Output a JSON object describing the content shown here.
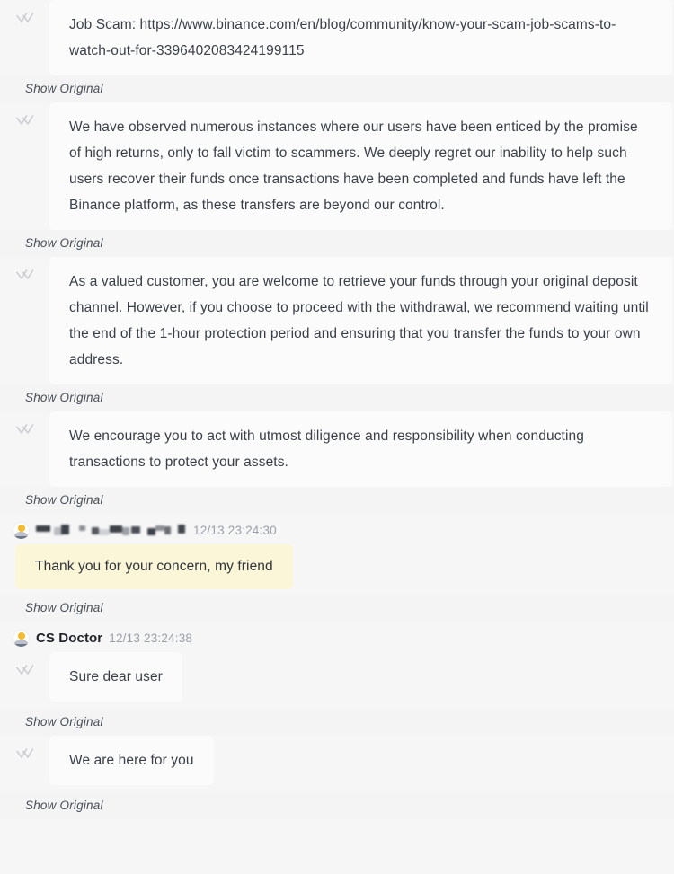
{
  "app": {
    "view_name": "customer-support-chat-transcript",
    "background_color": "#f6f6f7",
    "agent_bubble_color": "#fbfbfc",
    "user_bubble_color": "#fcf6d8",
    "accent_color": "#f3ba2f",
    "show_original_label": "Show Original"
  },
  "messages": [
    {
      "id": "m1",
      "sender": "agent",
      "status_icon": "double-check-icon",
      "text": "Job Scam: https://www.binance.com/en/blog/community/know-your-scam-job-scams-to-watch-out-for-3396402083424199115",
      "show_original": "Show Original"
    },
    {
      "id": "m2",
      "sender": "agent",
      "status_icon": "double-check-icon",
      "text": "We have observed numerous instances where our users have been enticed by the promise of high returns, only to fall victim to scammers. We deeply regret our inability to help such users recover their funds once transactions have been completed and funds have left the Binance platform, as these transfers are beyond our control.",
      "show_original": "Show Original"
    },
    {
      "id": "m3",
      "sender": "agent",
      "status_icon": "double-check-icon",
      "text": "As a valued customer, you are welcome to retrieve your funds through your original deposit channel. However, if you choose to proceed with the withdrawal, we recommend waiting until the end of the 1-hour protection period and ensuring that you transfer the funds to your own address.",
      "show_original": "Show Original"
    },
    {
      "id": "m4",
      "sender": "agent",
      "status_icon": "double-check-icon",
      "text": "We encourage you to act with utmost diligence and responsibility when conducting transactions to protect your assets.",
      "show_original": "Show Original"
    },
    {
      "id": "m5",
      "sender": "user",
      "avatar_icon": "binance-sun-avatar-icon",
      "name_redacted": true,
      "name": "",
      "timestamp": "12/13 23:24:30",
      "text": "Thank you for your concern, my friend",
      "show_original": "Show Original"
    },
    {
      "id": "m6",
      "sender": "agent",
      "avatar_icon": "binance-sun-avatar-icon",
      "name": "CS Doctor",
      "timestamp": "12/13 23:24:38",
      "status_icon": "double-check-icon",
      "text": "Sure dear user",
      "show_original": "Show Original"
    },
    {
      "id": "m7",
      "sender": "agent",
      "status_icon": "double-check-icon",
      "text": "We are here for you",
      "show_original": "Show Original"
    }
  ]
}
